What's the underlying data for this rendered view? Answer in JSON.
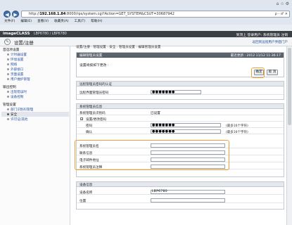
{
  "browser": {
    "url_prefix": "http://",
    "url_host": "192.168.1.84",
    "url_rest": ":8000/rps/system.cgi?Action=GET_SYSTEM&CSUT=30687942",
    "search_glyph": "ρ - ♂ ✕",
    "menu": [
      "文件(F)",
      "编辑(E)",
      "查看(V)",
      "收藏夹(A)",
      "工具(T)",
      "帮助(H)"
    ],
    "back_glyph": "◀",
    "forward_glyph": "▶",
    "window_tools": "⌂ ☆ ⚙"
  },
  "header": {
    "brand": "imageCLASS",
    "model": "LBP6780 / LBP6780",
    "right_text": "到顶上   登录用户: 系统管理员 注销",
    "page_title": "设置/注册",
    "page_icon": "✎",
    "to_portal": "返回到远程用户界面门户"
  },
  "sidebar": {
    "sections": [
      {
        "label": "首选项设置",
        "items": [
          "计时器设置",
          "环境设置",
          "网络",
          "外部接口",
          "页面设置",
          "用户维护管理"
        ]
      },
      {
        "label": "输出控制",
        "items": [
          "出现错误时",
          "设备控制"
        ]
      },
      {
        "label": "管理设置",
        "items": [
          "部门识别码管理",
          "安全",
          "许可证/其他"
        ]
      }
    ],
    "active_item": "安全"
  },
  "breadcrumb": "设置/注册 : 管理设置 : 安全 : 管理员设置 : 编辑管理员设置",
  "edit_panel": {
    "title": "编辑管理员设置",
    "timestamp": "最近更新 : 2012 11/12 11:36:17",
    "message": "设置将按如下更改 :",
    "ok_label": "确定",
    "cancel_label": "取 消"
  },
  "remote_auth": {
    "title": "远程管理员密码的认证",
    "label": "远程界面管理员密码",
    "value": "●●●●●●●"
  },
  "sysmgr": {
    "title": "系统管理员信息",
    "id_label": "系统管理员识别码",
    "id_value": "已设置",
    "set_checkbox_label": "设置/更改密码",
    "password_label": "密码",
    "password_value": "●●●●●●●",
    "password_hint": "(最多16个字符)",
    "confirm_label": "确认",
    "confirm_value": "●●●●●●●",
    "confirm_hint": "(最多16个字符)",
    "name_label": "系统管理员名",
    "contact_label": "联系信息",
    "email_label": "电子邮件地址",
    "comment_label": "系统管理员注释"
  },
  "device_info": {
    "title": "设备信息",
    "name_label": "设备名称",
    "name_value": "LBP6780",
    "location_label": "位置"
  },
  "colors": {
    "header_bg": "#3b3f46",
    "panel_dark": "#5a626c",
    "highlight": "#f0a030",
    "link": "#2a55a0"
  }
}
